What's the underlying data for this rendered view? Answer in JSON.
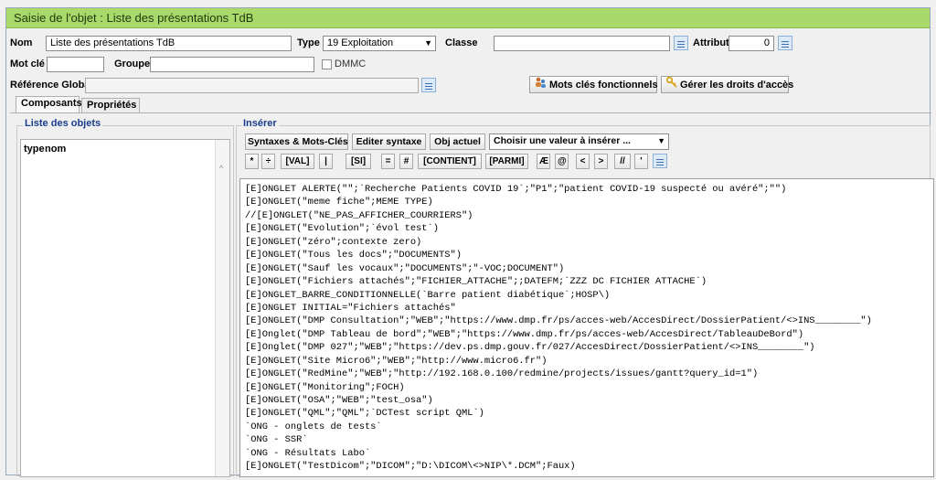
{
  "window": {
    "title": "Saisie de l'objet : Liste des présentations TdB"
  },
  "form": {
    "nom_label": "Nom",
    "nom_value": "Liste des présentations TdB",
    "type_label": "Type",
    "type_value": "19 Exploitation",
    "classe_label": "Classe",
    "classe_value": "",
    "attribut_label": "Attribut",
    "attribut_value": "0",
    "motcle_label": "Mot clé",
    "motcle_value": "",
    "groupe_label": "Groupe",
    "groupe_value": "",
    "dmmc_label": "DMMC",
    "dmmc_checked": false,
    "refglobale_label": "Référence Globale",
    "refglobale_value": ""
  },
  "actions": {
    "mots_cles": "Mots clés fonctionnels",
    "droits": "Gérer les droits d'accès"
  },
  "tabs": [
    {
      "label": "Composants",
      "active": true
    },
    {
      "label": "Propriétés",
      "active": false
    }
  ],
  "objects": {
    "legend": "Liste des objets",
    "col_type": "type",
    "col_nom": "nom"
  },
  "insert": {
    "legend": "Insérer",
    "syntaxes": "Syntaxes & Mots-Clés",
    "editer": "Editer syntaxe",
    "obj_actuel": "Obj actuel",
    "choisir": "Choisir une valeur à insérer ...",
    "tokens": [
      "*",
      "÷",
      "[VAL]",
      "|",
      "[SI]",
      "=",
      "#",
      "[CONTIENT]",
      "[PARMI]",
      "Æ",
      "@",
      "<",
      ">",
      "//",
      "'"
    ]
  },
  "code_lines": [
    "[E]ONGLET ALERTE(\"\";`Recherche Patients COVID 19`;\"P1\";\"patient COVID-19 suspecté ou avéré\";\"\")",
    "[E]ONGLET(\"meme fiche\";MEME TYPE)",
    "//[E]ONGLET(\"NE_PAS_AFFICHER_COURRIERS\")",
    "[E]ONGLET(\"Evolution\";`évol test`)",
    "[E]ONGLET(\"zéro\";contexte zero)",
    "[E]ONGLET(\"Tous les docs\";\"DOCUMENTS\")",
    "[E]ONGLET(\"Sauf les vocaux\";\"DOCUMENTS\";\"-VOC;DOCUMENT\")",
    "[E]ONGLET(\"Fichiers attachés\";\"FICHIER_ATTACHE\";;DATEFM;`ZZZ DC FICHIER ATTACHE`)",
    "[E]ONGLET_BARRE_CONDITIONNELLE(`Barre patient diabétique`;HOSP\\)",
    "[E]ONGLET INITIAL=\"Fichiers attachés\"",
    "[E]ONGLET(\"DMP Consultation\";\"WEB\";\"https://www.dmp.fr/ps/acces-web/AccesDirect/DossierPatient/<>INS________\")",
    "[E]Onglet(\"DMP Tableau de bord\";\"WEB\";\"https://www.dmp.fr/ps/acces-web/AccesDirect/TableauDeBord\")",
    "[E]Onglet(\"DMP 027\";\"WEB\";\"https://dev.ps.dmp.gouv.fr/027/AccesDirect/DossierPatient/<>INS________\")",
    "[E]ONGLET(\"Site Micro6\";\"WEB\";\"http://www.micro6.fr\")",
    "[E]ONGLET(\"RedMine\";\"WEB\";\"http://192.168.0.100/redmine/projects/issues/gantt?query_id=1\")",
    "[E]ONGLET(\"Monitoring\";FOCH)",
    "[E]ONGLET(\"OSA\";\"WEB\";\"test_osa\")",
    "[E]ONGLET(\"QML\";\"QML\";`DCTest script QML`)",
    "`ONG - onglets de tests`",
    "`ONG - SSR`",
    "`ONG - Résultats Labo`",
    "[E]ONGLET(\"TestDicom\";\"DICOM\";\"D:\\DICOM\\<>NIP\\*.DCM\";Faux)"
  ]
}
